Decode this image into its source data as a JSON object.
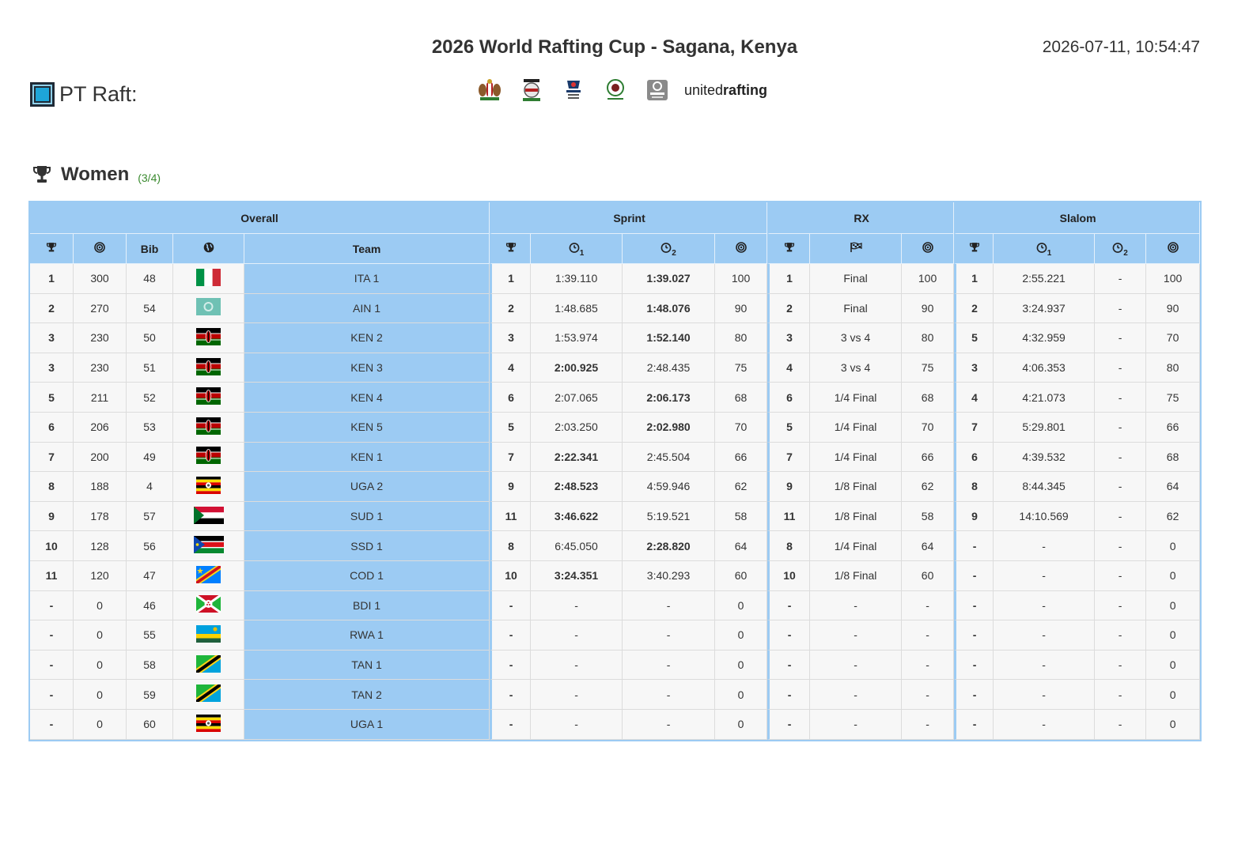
{
  "header": {
    "title": "2026 World Rafting Cup - Sagana, Kenya",
    "timestamp": "2026-07-11, 10:54:47",
    "brand": "PT Raft:",
    "sponsor_text_light": "united",
    "sponsor_text_bold": "rafting",
    "sponsor_icons": [
      "kenya-coat-of-arms-icon",
      "kenya-badge-icon",
      "rafting-cup-icon",
      "development-fund-icon",
      "rafting-federation-icon"
    ]
  },
  "category": {
    "name": "Women",
    "progress": "(3/4)"
  },
  "table": {
    "groups": [
      "Overall",
      "Sprint",
      "RX",
      "Slalom"
    ],
    "subheaders": {
      "bib": "Bib",
      "team": "Team",
      "t1": "1",
      "t2": "2"
    },
    "rows": [
      {
        "rank": "1",
        "pts": "300",
        "bib": "48",
        "flag": "ITA",
        "team": "ITA 1",
        "s_rank": "1",
        "s_t1": "1:39.110",
        "s_t2": "1:39.027",
        "s_best": 2,
        "s_pts": "100",
        "rx_rank": "1",
        "rx_stage": "Final",
        "rx_pts": "100",
        "sl_rank": "1",
        "sl_t1": "2:55.221",
        "sl_t2": "-",
        "sl_pts": "100"
      },
      {
        "rank": "2",
        "pts": "270",
        "bib": "54",
        "flag": "AIN",
        "team": "AIN 1",
        "s_rank": "2",
        "s_t1": "1:48.685",
        "s_t2": "1:48.076",
        "s_best": 2,
        "s_pts": "90",
        "rx_rank": "2",
        "rx_stage": "Final",
        "rx_pts": "90",
        "sl_rank": "2",
        "sl_t1": "3:24.937",
        "sl_t2": "-",
        "sl_pts": "90"
      },
      {
        "rank": "3",
        "pts": "230",
        "bib": "50",
        "flag": "KEN",
        "team": "KEN 2",
        "s_rank": "3",
        "s_t1": "1:53.974",
        "s_t2": "1:52.140",
        "s_best": 2,
        "s_pts": "80",
        "rx_rank": "3",
        "rx_stage": "3 vs 4",
        "rx_pts": "80",
        "sl_rank": "5",
        "sl_t1": "4:32.959",
        "sl_t2": "-",
        "sl_pts": "70"
      },
      {
        "rank": "3",
        "pts": "230",
        "bib": "51",
        "flag": "KEN",
        "team": "KEN 3",
        "s_rank": "4",
        "s_t1": "2:00.925",
        "s_t2": "2:48.435",
        "s_best": 1,
        "s_pts": "75",
        "rx_rank": "4",
        "rx_stage": "3 vs 4",
        "rx_pts": "75",
        "sl_rank": "3",
        "sl_t1": "4:06.353",
        "sl_t2": "-",
        "sl_pts": "80"
      },
      {
        "rank": "5",
        "pts": "211",
        "bib": "52",
        "flag": "KEN",
        "team": "KEN 4",
        "s_rank": "6",
        "s_t1": "2:07.065",
        "s_t2": "2:06.173",
        "s_best": 2,
        "s_pts": "68",
        "rx_rank": "6",
        "rx_stage": "1/4 Final",
        "rx_pts": "68",
        "sl_rank": "4",
        "sl_t1": "4:21.073",
        "sl_t2": "-",
        "sl_pts": "75"
      },
      {
        "rank": "6",
        "pts": "206",
        "bib": "53",
        "flag": "KEN",
        "team": "KEN 5",
        "s_rank": "5",
        "s_t1": "2:03.250",
        "s_t2": "2:02.980",
        "s_best": 2,
        "s_pts": "70",
        "rx_rank": "5",
        "rx_stage": "1/4 Final",
        "rx_pts": "70",
        "sl_rank": "7",
        "sl_t1": "5:29.801",
        "sl_t2": "-",
        "sl_pts": "66"
      },
      {
        "rank": "7",
        "pts": "200",
        "bib": "49",
        "flag": "KEN",
        "team": "KEN 1",
        "s_rank": "7",
        "s_t1": "2:22.341",
        "s_t2": "2:45.504",
        "s_best": 1,
        "s_pts": "66",
        "rx_rank": "7",
        "rx_stage": "1/4 Final",
        "rx_pts": "66",
        "sl_rank": "6",
        "sl_t1": "4:39.532",
        "sl_t2": "-",
        "sl_pts": "68"
      },
      {
        "rank": "8",
        "pts": "188",
        "bib": "4",
        "flag": "UGA",
        "team": "UGA 2",
        "s_rank": "9",
        "s_t1": "2:48.523",
        "s_t2": "4:59.946",
        "s_best": 1,
        "s_pts": "62",
        "rx_rank": "9",
        "rx_stage": "1/8 Final",
        "rx_pts": "62",
        "sl_rank": "8",
        "sl_t1": "8:44.345",
        "sl_t2": "-",
        "sl_pts": "64"
      },
      {
        "rank": "9",
        "pts": "178",
        "bib": "57",
        "flag": "SUD",
        "team": "SUD 1",
        "s_rank": "11",
        "s_t1": "3:46.622",
        "s_t2": "5:19.521",
        "s_best": 1,
        "s_pts": "58",
        "rx_rank": "11",
        "rx_stage": "1/8 Final",
        "rx_pts": "58",
        "sl_rank": "9",
        "sl_t1": "14:10.569",
        "sl_t2": "-",
        "sl_pts": "62"
      },
      {
        "rank": "10",
        "pts": "128",
        "bib": "56",
        "flag": "SSD",
        "team": "SSD 1",
        "s_rank": "8",
        "s_t1": "6:45.050",
        "s_t2": "2:28.820",
        "s_best": 2,
        "s_pts": "64",
        "rx_rank": "8",
        "rx_stage": "1/4 Final",
        "rx_pts": "64",
        "sl_rank": "-",
        "sl_t1": "-",
        "sl_t2": "-",
        "sl_pts": "0"
      },
      {
        "rank": "11",
        "pts": "120",
        "bib": "47",
        "flag": "COD",
        "team": "COD 1",
        "s_rank": "10",
        "s_t1": "3:24.351",
        "s_t2": "3:40.293",
        "s_best": 1,
        "s_pts": "60",
        "rx_rank": "10",
        "rx_stage": "1/8 Final",
        "rx_pts": "60",
        "sl_rank": "-",
        "sl_t1": "-",
        "sl_t2": "-",
        "sl_pts": "0"
      },
      {
        "rank": "-",
        "pts": "0",
        "bib": "46",
        "flag": "BDI",
        "team": "BDI 1",
        "s_rank": "-",
        "s_t1": "-",
        "s_t2": "-",
        "s_best": 0,
        "s_pts": "0",
        "rx_rank": "-",
        "rx_stage": "-",
        "rx_pts": "-",
        "sl_rank": "-",
        "sl_t1": "-",
        "sl_t2": "-",
        "sl_pts": "0"
      },
      {
        "rank": "-",
        "pts": "0",
        "bib": "55",
        "flag": "RWA",
        "team": "RWA 1",
        "s_rank": "-",
        "s_t1": "-",
        "s_t2": "-",
        "s_best": 0,
        "s_pts": "0",
        "rx_rank": "-",
        "rx_stage": "-",
        "rx_pts": "-",
        "sl_rank": "-",
        "sl_t1": "-",
        "sl_t2": "-",
        "sl_pts": "0"
      },
      {
        "rank": "-",
        "pts": "0",
        "bib": "58",
        "flag": "TAN",
        "team": "TAN 1",
        "s_rank": "-",
        "s_t1": "-",
        "s_t2": "-",
        "s_best": 0,
        "s_pts": "0",
        "rx_rank": "-",
        "rx_stage": "-",
        "rx_pts": "-",
        "sl_rank": "-",
        "sl_t1": "-",
        "sl_t2": "-",
        "sl_pts": "0"
      },
      {
        "rank": "-",
        "pts": "0",
        "bib": "59",
        "flag": "TAN",
        "team": "TAN 2",
        "s_rank": "-",
        "s_t1": "-",
        "s_t2": "-",
        "s_best": 0,
        "s_pts": "0",
        "rx_rank": "-",
        "rx_stage": "-",
        "rx_pts": "-",
        "sl_rank": "-",
        "sl_t1": "-",
        "sl_t2": "-",
        "sl_pts": "0"
      },
      {
        "rank": "-",
        "pts": "0",
        "bib": "60",
        "flag": "UGA",
        "team": "UGA 1",
        "s_rank": "-",
        "s_t1": "-",
        "s_t2": "-",
        "s_best": 0,
        "s_pts": "0",
        "rx_rank": "-",
        "rx_stage": "-",
        "rx_pts": "-",
        "sl_rank": "-",
        "sl_t1": "-",
        "sl_t2": "-",
        "sl_pts": "0"
      }
    ]
  },
  "colors": {
    "header_blue": "#9ccbf3",
    "cell_bg": "#f7f7f7",
    "progress_green": "#3a8a2f"
  }
}
